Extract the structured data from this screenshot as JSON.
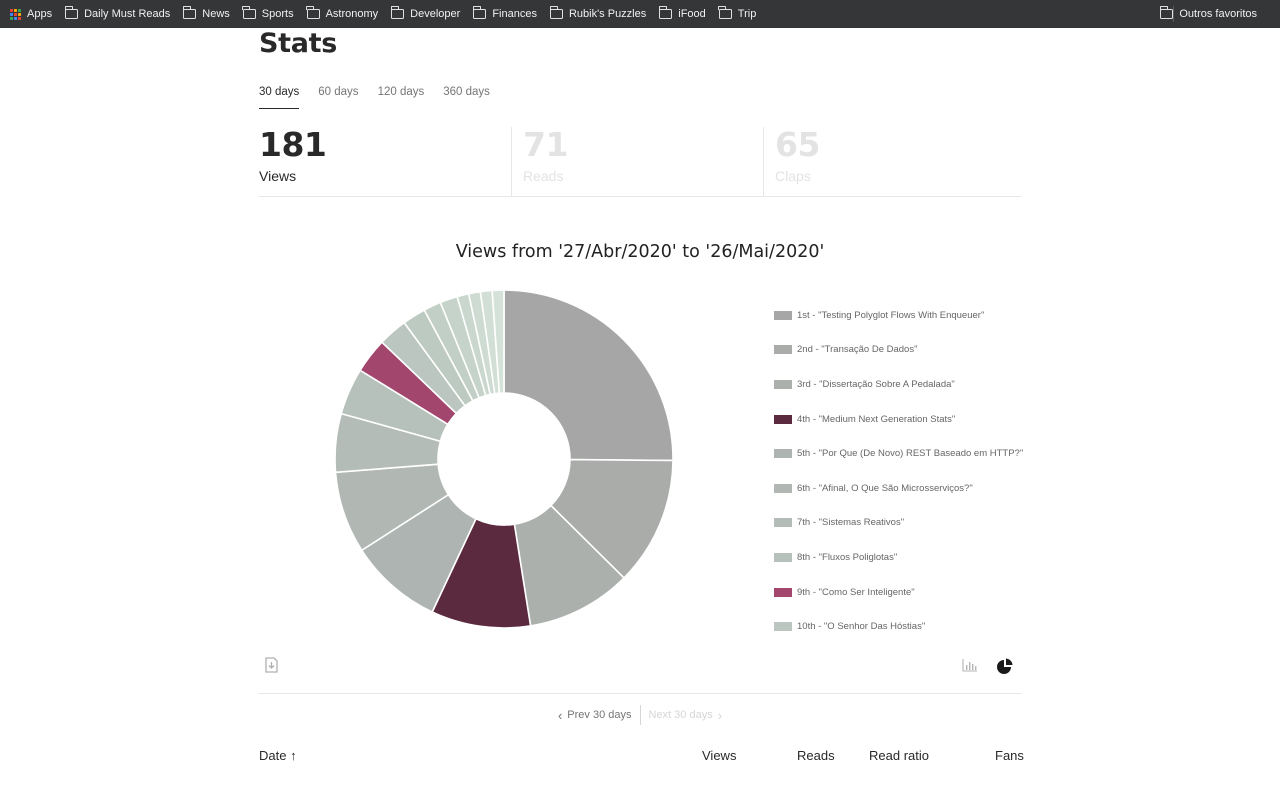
{
  "bookmarks": {
    "apps_label": "Apps",
    "items": [
      "Daily Must Reads",
      "News",
      "Sports",
      "Astronomy",
      "Developer",
      "Finances",
      "Rubik's Puzzles",
      "iFood",
      "Trip"
    ],
    "other_label": "Outros favoritos"
  },
  "page": {
    "title": "Stats",
    "tabs": [
      "30 days",
      "60 days",
      "120 days",
      "360 days"
    ],
    "active_tab": "30 days"
  },
  "metrics": {
    "views": {
      "value": "181",
      "label": "Views"
    },
    "reads": {
      "value": "71",
      "label": "Reads"
    },
    "claps": {
      "value": "65",
      "label": "Claps"
    }
  },
  "chart_data": {
    "type": "pie",
    "title": "Views from '27/Abr/2020' to '26/Mai/2020'",
    "donut": true,
    "legend_position": "right",
    "series": [
      {
        "name": "1st - \"Testing Polyglot Flows With Enqueuer\"",
        "value": 45,
        "color": "#a6a6a6"
      },
      {
        "name": "2nd - \"Transação De Dados\"",
        "value": 22,
        "color": "#a9aca9"
      },
      {
        "name": "3rd - \"Dissertação Sobre A Pedalada\"",
        "value": 18,
        "color": "#abb0ad"
      },
      {
        "name": "4th - \"Medium Next Generation Stats\"",
        "value": 17,
        "color": "#5c2a3e"
      },
      {
        "name": "5th - \"Por Que (De Novo) REST Baseado em HTTP?\"",
        "value": 16,
        "color": "#aeb4b1"
      },
      {
        "name": "6th - \"Afinal, O Que São Microsserviços?\"",
        "value": 14,
        "color": "#b1b8b4"
      },
      {
        "name": "7th - \"Sistemas Reativos\"",
        "value": 10,
        "color": "#b4bcb8"
      },
      {
        "name": "8th - \"Fluxos Poliglotas\"",
        "value": 8,
        "color": "#b7c1bb"
      },
      {
        "name": "9th - \"Como Ser Inteligente\"",
        "value": 6,
        "color": "#a2466e"
      },
      {
        "name": "10th - \"O Senhor Das Hóstias\"",
        "value": 5,
        "color": "#bac6bf"
      },
      {
        "name": "",
        "value": 4,
        "color": "#bdcac2"
      },
      {
        "name": "",
        "value": 3,
        "color": "#c1cfc6"
      },
      {
        "name": "",
        "value": 3,
        "color": "#c5d3ca"
      },
      {
        "name": "",
        "value": 2,
        "color": "#c9d7ce"
      },
      {
        "name": "",
        "value": 2,
        "color": "#cddbd2"
      },
      {
        "name": "",
        "value": 2,
        "color": "#d1dfd6"
      },
      {
        "name": "",
        "value": 2,
        "color": "#d4e2d9"
      }
    ]
  },
  "controls": {
    "download_icon": "download-icon",
    "bar_chart_icon": "bar-chart-icon",
    "pie_chart_icon": "pie-chart-icon"
  },
  "pager": {
    "prev_label": "Prev 30 days",
    "next_label": "Next 30 days"
  },
  "table": {
    "headers": {
      "date": "Date",
      "views": "Views",
      "reads": "Reads",
      "read_ratio": "Read ratio",
      "fans": "Fans"
    },
    "sort_icon": "↑"
  }
}
